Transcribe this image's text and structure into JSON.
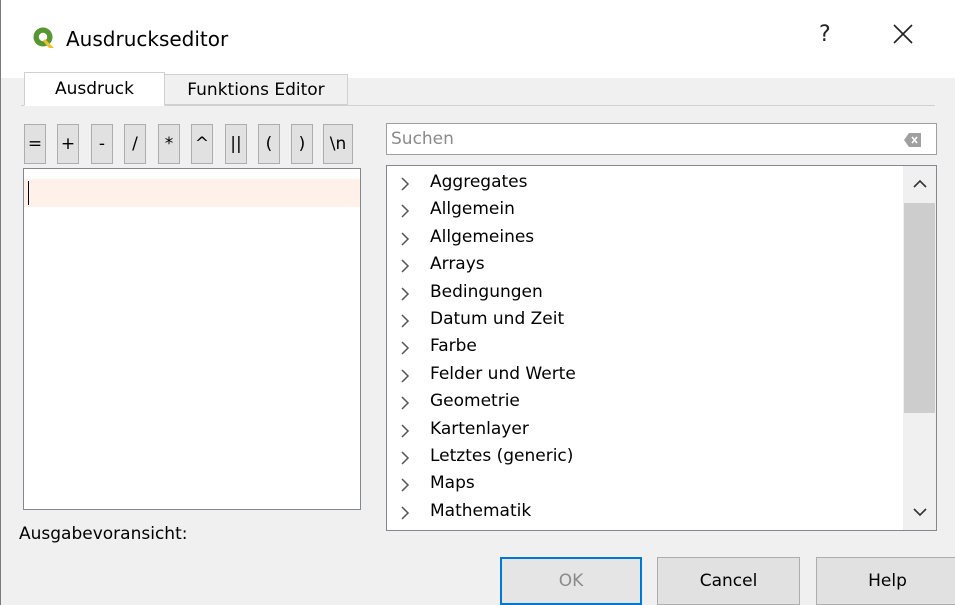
{
  "window": {
    "title": "Ausdruckseditor",
    "help_label": "?",
    "icon": "qgis-logo-icon"
  },
  "tabs": [
    {
      "label": "Ausdruck",
      "active": true
    },
    {
      "label": "Funktions Editor",
      "active": false
    }
  ],
  "operators": [
    "=",
    "+",
    "-",
    "/",
    "*",
    "^",
    "||",
    "(",
    ")",
    "\\n"
  ],
  "editor": {
    "value": ""
  },
  "preview": {
    "label": "Ausgabevoransicht:"
  },
  "search": {
    "placeholder": "Suchen",
    "value": ""
  },
  "function_tree": {
    "items": [
      "Aggregates",
      "Allgemein",
      "Allgemeines",
      "Arrays",
      "Bedingungen",
      "Datum und Zeit",
      "Farbe",
      "Felder und Werte",
      "Geometrie",
      "Kartenlayer",
      "Letztes (generic)",
      "Maps",
      "Mathematik"
    ]
  },
  "buttons": {
    "ok": "OK",
    "cancel": "Cancel",
    "help": "Help"
  },
  "colors": {
    "accent": "#0078d7",
    "editor_highlight": "#fff0ea",
    "qgis_green": "#589632",
    "qgis_yellow": "#f0c02f"
  }
}
